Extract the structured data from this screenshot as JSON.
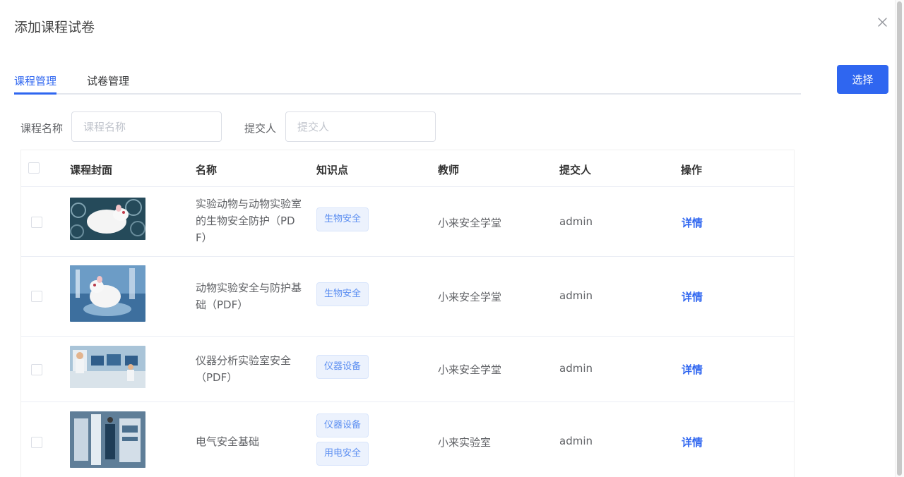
{
  "dialog": {
    "title": "添加课程试卷"
  },
  "tabs": [
    {
      "label": "课程管理",
      "active": true
    },
    {
      "label": "试卷管理",
      "active": false
    }
  ],
  "select_button": "选择",
  "filters": {
    "course_name_label": "课程名称",
    "course_name_placeholder": "课程名称",
    "submitter_label": "提交人",
    "submitter_placeholder": "提交人"
  },
  "table": {
    "headers": [
      "课程封面",
      "名称",
      "知识点",
      "教师",
      "提交人",
      "操作"
    ],
    "rows": [
      {
        "name": "实验动物与动物实验室的生物安全防护（PDF）",
        "tags": [
          "生物安全"
        ],
        "teacher": "小来安全学堂",
        "submitter": "admin",
        "action": "详情"
      },
      {
        "name": "动物实验安全与防护基础（PDF）",
        "tags": [
          "生物安全"
        ],
        "teacher": "小来安全学堂",
        "submitter": "admin",
        "action": "详情"
      },
      {
        "name": "仪器分析实验室安全（PDF）",
        "tags": [
          "仪器设备"
        ],
        "teacher": "小来安全学堂",
        "submitter": "admin",
        "action": "详情"
      },
      {
        "name": "电气安全基础",
        "tags": [
          "仪器设备",
          "用电安全"
        ],
        "teacher": "小来实验室",
        "submitter": "admin",
        "action": "详情"
      }
    ]
  },
  "colors": {
    "primary": "#2f66f0",
    "tag_bg": "#ecf2fd",
    "tag_text": "#5b8ef1"
  }
}
